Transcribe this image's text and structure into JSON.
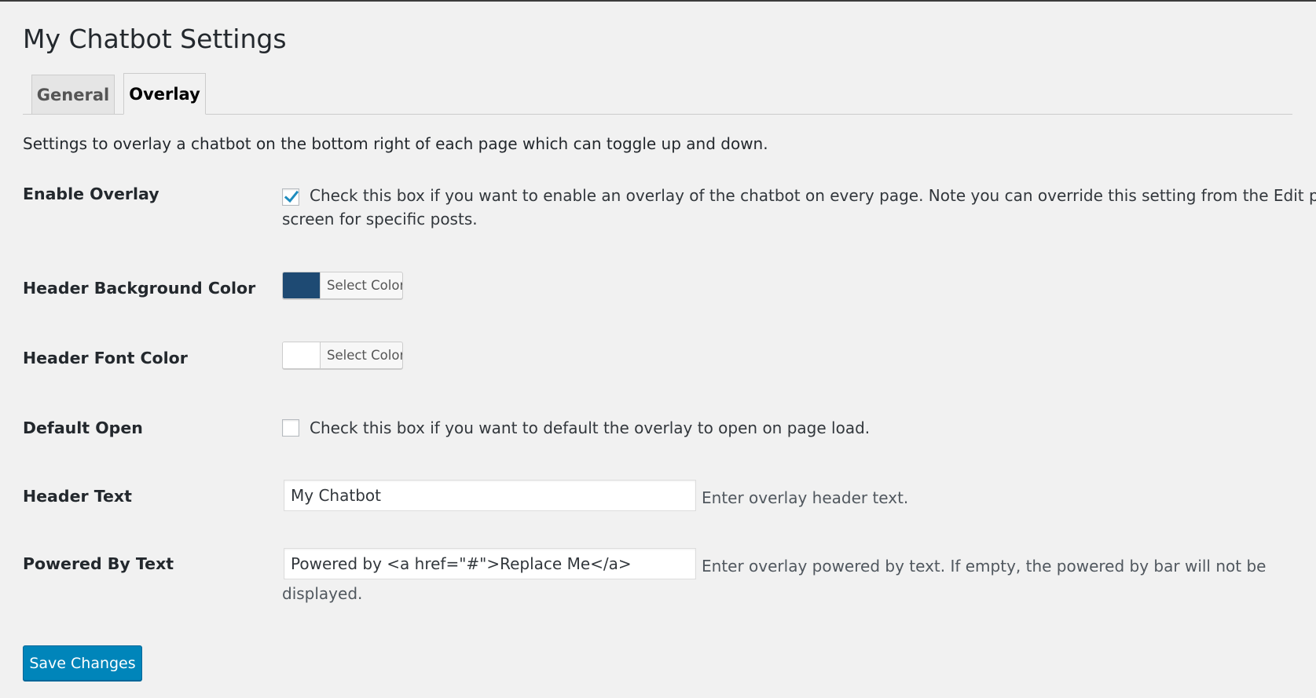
{
  "page": {
    "title": "My Chatbot Settings",
    "description": "Settings to overlay a chatbot on the bottom right of each page which can toggle up and down."
  },
  "tabs": [
    {
      "label": "General",
      "active": false
    },
    {
      "label": "Overlay",
      "active": true
    }
  ],
  "rows": {
    "enable_overlay": {
      "label": "Enable Overlay",
      "checked": true,
      "text_line1": "Check this box if you want to enable an overlay of the chatbot on every page. Note you can override this setting from the Edit post",
      "text_line2": "screen for specific posts."
    },
    "header_bg_color": {
      "label": "Header Background Color",
      "button_label": "Select Color",
      "color": "#1e4a73"
    },
    "header_font_color": {
      "label": "Header Font Color",
      "button_label": "Select Color",
      "color": "#ffffff"
    },
    "default_open": {
      "label": "Default Open",
      "checked": false,
      "text": "Check this box if you want to default the overlay to open on page load."
    },
    "header_text": {
      "label": "Header Text",
      "value": "My Chatbot",
      "hint": "Enter overlay header text."
    },
    "powered_by_text": {
      "label": "Powered By Text",
      "value": "Powered by <a href=\"#\">Replace Me</a>",
      "hint_line1": "Enter overlay powered by text. If empty, the powered by bar will not be",
      "hint_line2": "displayed."
    }
  },
  "actions": {
    "save_label": "Save Changes"
  },
  "colors": {
    "primary_button": "#0085ba",
    "background": "#f1f1f1",
    "check_mark": "#1e8cbe"
  },
  "icons": {
    "checkmark": "check-icon"
  }
}
